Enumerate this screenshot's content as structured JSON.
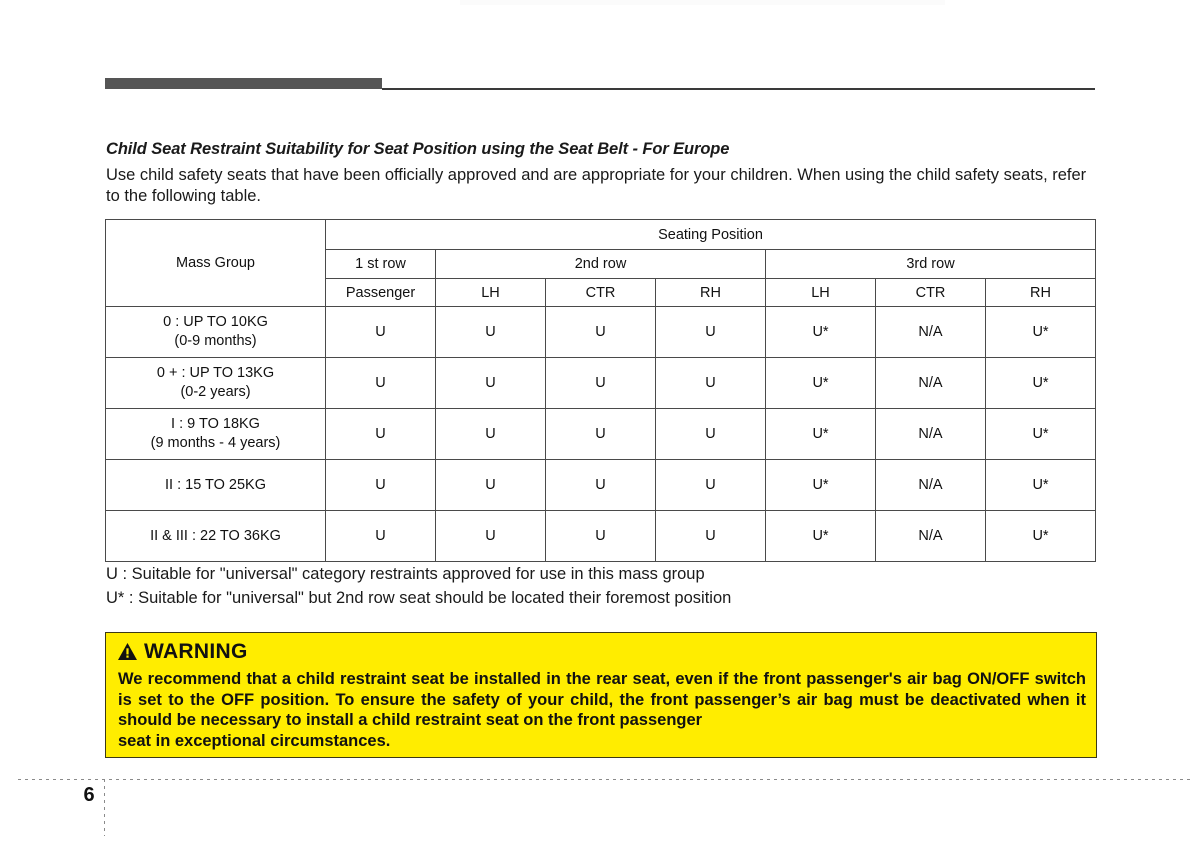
{
  "page": {
    "number": "6"
  },
  "section": {
    "title": "Child Seat Restraint Suitability for Seat Position using the Seat Belt - For Europe",
    "intro": "Use child safety seats that have been officially approved and are appropriate for your children. When using the child safety seats, refer to the following table."
  },
  "table": {
    "mass_group_header": "Mass Group",
    "seating_position_header": "Seating Position",
    "row_groups": [
      "1 st row",
      "2nd row",
      "3rd row"
    ],
    "sub_headers": [
      "Passenger",
      "LH",
      "CTR",
      "RH",
      "LH",
      "CTR",
      "RH"
    ],
    "rows": [
      {
        "mass_line1": "0 : UP TO 10KG",
        "mass_line2": "(0-9 months)",
        "values": [
          "U",
          "U",
          "U",
          "U",
          "U*",
          "N/A",
          "U*"
        ]
      },
      {
        "mass_line1": "0 + : UP TO 13KG",
        "mass_line2": "(0-2 years)",
        "values": [
          "U",
          "U",
          "U",
          "U",
          "U*",
          "N/A",
          "U*"
        ]
      },
      {
        "mass_line1": "I : 9 TO 18KG",
        "mass_line2": "(9 months - 4 years)",
        "values": [
          "U",
          "U",
          "U",
          "U",
          "U*",
          "N/A",
          "U*"
        ]
      },
      {
        "mass_line1": "II : 15 TO 25KG",
        "mass_line2": "",
        "values": [
          "U",
          "U",
          "U",
          "U",
          "U*",
          "N/A",
          "U*"
        ]
      },
      {
        "mass_line1": "II & III : 22 TO 36KG",
        "mass_line2": "",
        "values": [
          "U",
          "U",
          "U",
          "U",
          "U*",
          "N/A",
          "U*"
        ]
      }
    ]
  },
  "legend": {
    "line1": "U : Suitable for \"universal\" category restraints approved for use in this mass group",
    "line2": "U* : Suitable for \"universal\" but 2nd row seat should be located their foremost position"
  },
  "warning": {
    "label": "WARNING",
    "icon": "warning-triangle-icon",
    "body": "We recommend that a child restraint  seat be installed in the rear seat, even if the front passenger's air bag ON/OFF switch is set to the OFF position. To ensure the safety of your child, the front passenger’s air bag must be deactivated when it should be necessary to install a child restraint seat on the front passenger",
    "body_last_line": "seat in exceptional circumstances.",
    "background_color": "#ffed00",
    "text_color": "#111111"
  }
}
